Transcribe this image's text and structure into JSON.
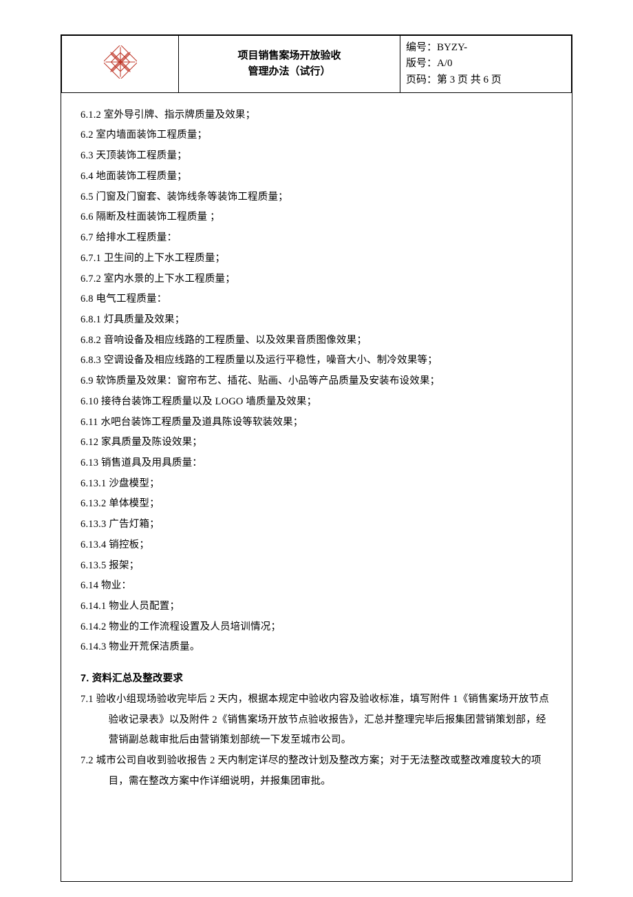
{
  "header": {
    "title_line1": "项目销售案场开放验收",
    "title_line2": "管理办法（试行）",
    "code_label": "编号：",
    "code_value": "BYZY-",
    "version_label": "版号：",
    "version_value": "A/0",
    "page_label": "页码：",
    "page_value": "第 3 页 共 6 页"
  },
  "items": [
    {
      "num": "6.1.2",
      "text": "室外导引牌、指示牌质量及效果；"
    },
    {
      "num": "6.2",
      "text": "室内墙面装饰工程质量；"
    },
    {
      "num": "6.3",
      "text": "天顶装饰工程质量；"
    },
    {
      "num": "6.4",
      "text": "地面装饰工程质量；"
    },
    {
      "num": "6.5",
      "text": "门窗及门窗套、装饰线条等装饰工程质量；"
    },
    {
      "num": "6.6",
      "text": "隔断及柱面装饰工程质量 ；"
    },
    {
      "num": "6.7",
      "text": "给排水工程质量："
    },
    {
      "num": "6.7.1",
      "text": "卫生间的上下水工程质量；"
    },
    {
      "num": "6.7.2",
      "text": "室内水景的上下水工程质量；"
    },
    {
      "num": "6.8",
      "text": "电气工程质量："
    },
    {
      "num": "6.8.1",
      "text": "灯具质量及效果；"
    },
    {
      "num": "6.8.2",
      "text": "音响设备及相应线路的工程质量、以及效果音质图像效果；"
    },
    {
      "num": "6.8.3",
      "text": "空调设备及相应线路的工程质量以及运行平稳性，噪音大小、制冷效果等；"
    },
    {
      "num": "6.9",
      "text": "软饰质量及效果：窗帘布艺、插花、贴画、小品等产品质量及安装布设效果；"
    },
    {
      "num": "6.10",
      "text": "接待台装饰工程质量以及 LOGO 墙质量及效果；"
    },
    {
      "num": "6.11",
      "text": " 水吧台装饰工程质量及道具陈设等软装效果；"
    },
    {
      "num": "6.12",
      "text": "家具质量及陈设效果；"
    },
    {
      "num": "6.13",
      "text": "销售道具及用具质量："
    },
    {
      "num": "6.13.1",
      "text": "沙盘模型；"
    },
    {
      "num": "6.13.2",
      "text": "单体模型；"
    },
    {
      "num": "6.13.3",
      "text": "广告灯箱；"
    },
    {
      "num": "6.13.4",
      "text": "销控板；"
    },
    {
      "num": "6.13.5",
      "text": "报架；"
    },
    {
      "num": "6.14",
      "text": "物业："
    },
    {
      "num": "6.14.1",
      "text": "物业人员配置；"
    },
    {
      "num": "6.14.2",
      "text": "物业的工作流程设置及人员培训情况；"
    },
    {
      "num": "6.14.3",
      "text": "物业开荒保洁质量。"
    }
  ],
  "section7": {
    "title": "7. 资料汇总及整改要求",
    "p1_num": "7.1",
    "p1_text": "验收小组现场验收完毕后 2 天内，根据本规定中验收内容及验收标准，填写附件 1《销售案场开放节点验收记录表》以及附件 2《销售案场开放节点验收报告》，汇总并整理完毕后报集团营销策划部，经营销副总裁审批后由营销策划部统一下发至城市公司。",
    "p2_num": "7.2",
    "p2_text": "城市公司自收到验收报告 2 天内制定详尽的整改计划及整改方案；对于无法整改或整改难度较大的项目，需在整改方案中作详细说明，并报集团审批。"
  }
}
